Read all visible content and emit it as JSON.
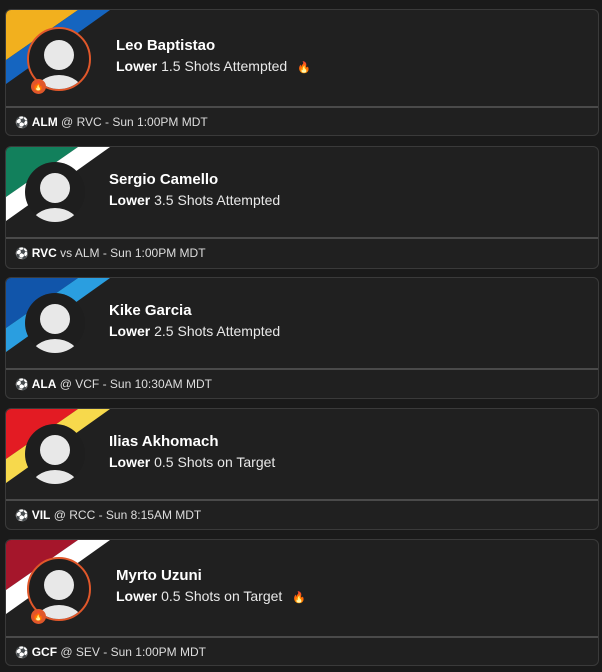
{
  "picks": [
    {
      "player": "Leo Baptistao",
      "direction": "Lower",
      "line": "1.5",
      "stat": "Shots Attempted",
      "hot": true,
      "team": "ALM",
      "matchup": "@ RVC - Sun 1:00PM MDT",
      "stripe_colors": [
        "#f2b01e",
        "#1565c0"
      ]
    },
    {
      "player": "Sergio Camello",
      "direction": "Lower",
      "line": "3.5",
      "stat": "Shots Attempted",
      "hot": false,
      "team": "RVC",
      "matchup": "vs ALM - Sun 1:00PM MDT",
      "stripe_colors": [
        "#12805c",
        "#ffffff"
      ]
    },
    {
      "player": "Kike Garcia",
      "direction": "Lower",
      "line": "2.5",
      "stat": "Shots Attempted",
      "hot": false,
      "team": "ALA",
      "matchup": "@ VCF - Sun 10:30AM MDT",
      "stripe_colors": [
        "#1155aa",
        "#2a9ee0"
      ]
    },
    {
      "player": "Ilias Akhomach",
      "direction": "Lower",
      "line": "0.5",
      "stat": "Shots on Target",
      "hot": false,
      "team": "VIL",
      "matchup": "@ RCC - Sun 8:15AM MDT",
      "stripe_colors": [
        "#e31b23",
        "#f7d94c"
      ]
    },
    {
      "player": "Myrto Uzuni",
      "direction": "Lower",
      "line": "0.5",
      "stat": "Shots on Target",
      "hot": true,
      "team": "GCF",
      "matchup": "@ SEV - Sun 1:00PM MDT",
      "stripe_colors": [
        "#a5162b",
        "#ffffff"
      ]
    }
  ],
  "colors": {
    "hot_accent": "#e0572a",
    "card_bg": "#202020",
    "page_bg": "#1a1a1a"
  },
  "icons": {
    "hot": "flame-icon",
    "sport": "soccer-ball-icon"
  }
}
